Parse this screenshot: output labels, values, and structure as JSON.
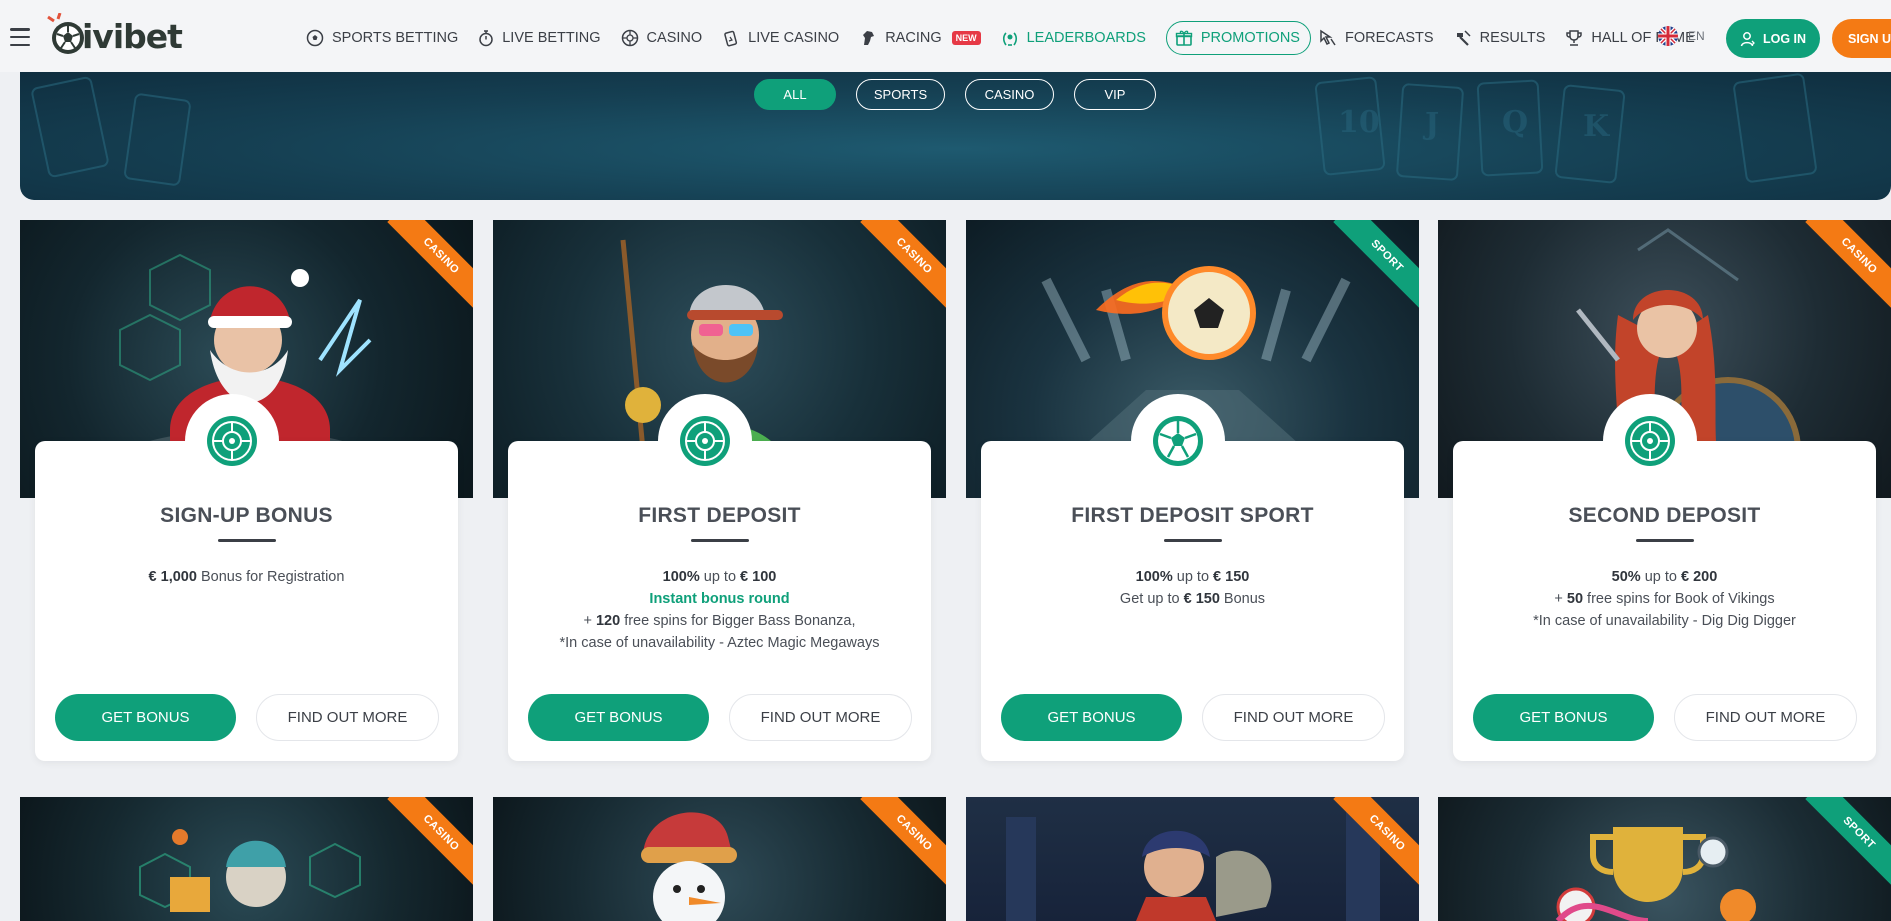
{
  "header": {
    "logo_text": "ivibet",
    "nav": [
      {
        "label": "SPORTS BETTING",
        "icon": "soccer-ball-icon"
      },
      {
        "label": "LIVE BETTING",
        "icon": "stopwatch-icon"
      },
      {
        "label": "CASINO",
        "icon": "roulette-icon"
      },
      {
        "label": "LIVE CASINO",
        "icon": "cards-icon"
      },
      {
        "label": "RACING",
        "icon": "horse-icon",
        "badge": "NEW"
      },
      {
        "label": "LEADERBOARDS",
        "icon": "laurel-icon"
      },
      {
        "label": "PROMOTIONS",
        "icon": "gift-icon"
      },
      {
        "label": "FORECASTS",
        "icon": "cursor-icon"
      },
      {
        "label": "RESULTS",
        "icon": "hammer-icon"
      },
      {
        "label": "HALL OF FAME",
        "icon": "trophy-icon"
      }
    ],
    "language": "EN",
    "login_label": "LOG IN",
    "signup_label": "SIGN UP"
  },
  "filters": [
    "ALL",
    "SPORTS",
    "CASINO",
    "VIP"
  ],
  "active_filter": "ALL",
  "cards": [
    {
      "tag": "CASINO",
      "title": "SIGN-UP BONUS",
      "desc": [
        [
          {
            "b": "€ 1,000"
          },
          {
            "t": " Bonus for Registration"
          }
        ]
      ],
      "get_label": "GET BONUS",
      "more_label": "FIND OUT MORE",
      "icon": "roulette-icon"
    },
    {
      "tag": "CASINO",
      "title": "FIRST DEPOSIT",
      "desc": [
        [
          {
            "b": "100%"
          },
          {
            "t": " up to "
          },
          {
            "b": "€ 100"
          }
        ],
        [
          {
            "teal": "Instant bonus round"
          }
        ],
        [
          {
            "t": "+ "
          },
          {
            "b": "120"
          },
          {
            "t": " free spins for Bigger Bass Bonanza,"
          }
        ],
        [
          {
            "t": "*In case of unavailability - Aztec Magic Megaways"
          }
        ]
      ],
      "get_label": "GET BONUS",
      "more_label": "FIND OUT MORE",
      "icon": "roulette-icon"
    },
    {
      "tag": "SPORT",
      "title": "FIRST DEPOSIT SPORT",
      "desc": [
        [
          {
            "b": "100%"
          },
          {
            "t": " up to "
          },
          {
            "b": "€ 150"
          }
        ],
        [
          {
            "t": "Get up to "
          },
          {
            "b": "€ 150"
          },
          {
            "t": " Bonus"
          }
        ]
      ],
      "get_label": "GET BONUS",
      "more_label": "FIND OUT MORE",
      "icon": "soccer-ball-icon"
    },
    {
      "tag": "CASINO",
      "title": "SECOND DEPOSIT",
      "desc": [
        [
          {
            "b": "50%"
          },
          {
            "t": " up to "
          },
          {
            "b": "€ 200"
          }
        ],
        [
          {
            "t": "+ "
          },
          {
            "b": "50"
          },
          {
            "t": " free spins for Book of Vikings"
          }
        ],
        [
          {
            "t": "*In case of unavailability - Dig Dig Digger"
          }
        ]
      ],
      "get_label": "GET BONUS",
      "more_label": "FIND OUT MORE",
      "icon": "roulette-icon"
    }
  ],
  "row2_tags": [
    "CASINO",
    "CASINO",
    "CASINO",
    "SPORT"
  ],
  "colors": {
    "brand_green": "#0fa07a",
    "brand_orange": "#f47a14",
    "badge_red": "#e63946"
  }
}
